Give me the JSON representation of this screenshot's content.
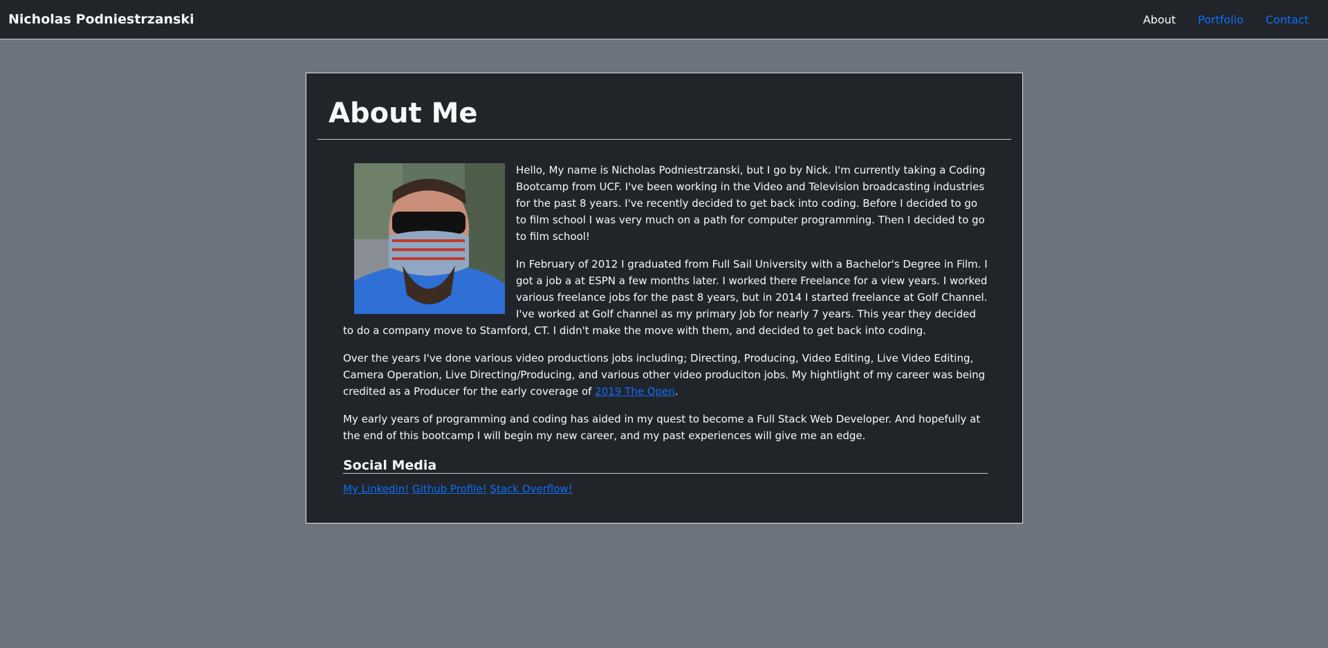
{
  "nav": {
    "brand": "Nicholas Podniestrzanski",
    "links": [
      {
        "label": "About",
        "active": true
      },
      {
        "label": "Portfolio",
        "active": false
      },
      {
        "label": "Contact",
        "active": false
      }
    ]
  },
  "about": {
    "title": "About Me",
    "paragraphs": [
      "Hello, My name is Nicholas Podniestrzanski, but I go by Nick. I'm currently taking a Coding Bootcamp from UCF. I've been working in the Video and Television broadcasting industries for the past 8 years. I've recently decided to get back into coding. Before I decided to go to film school I was very much on a path for computer programming. Then I decided to go to film school!",
      "In February of 2012 I graduated from Full Sail University with a Bachelor's Degree in Film. I got a job a at ESPN a few months later. I worked there Freelance for a view years. I worked various freelance jobs for the past 8 years, but in 2014 I started freelance at Golf Channel. I've worked at Golf channel as my primary Job for nearly 7 years. This year they decided to do a company move to Stamford, CT. I didn't make the move with them, and decided to get back into coding.",
      "My early years of programming and coding has aided in my quest to become a Full Stack Web Developer. And hopefully at the end of this bootcamp I will begin my new career, and my past experiences will give me an edge."
    ],
    "career_paragraph": {
      "before_link": "Over the years I've done various video productions jobs including; Directing, Producing, Video Editing, Live Video Editing, Camera Operation, Live Directing/Producing, and various other video produciton jobs. My hightlight of my career was being credited as a Producer for the early coverage of ",
      "link_text": "2019 The Open",
      "after_link": "."
    }
  },
  "social": {
    "heading": "Social Media",
    "links": [
      "My Linkedin!",
      "Github Profile!",
      "Stack Overflow!"
    ]
  },
  "colors": {
    "page_bg": "#6c757d",
    "panel_bg": "#212529",
    "link": "#0d6efd",
    "text": "#f8f9fa"
  }
}
